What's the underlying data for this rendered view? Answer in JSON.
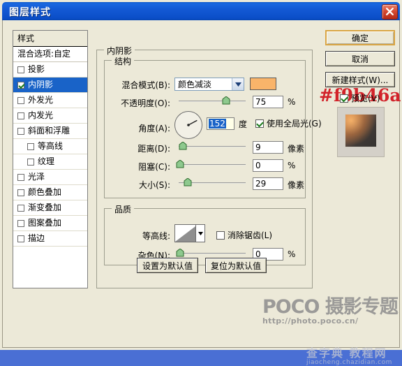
{
  "window": {
    "title": "图层样式",
    "close_icon": "close-icon",
    "titlebar_color": "#1359d4"
  },
  "sidebar": {
    "header": "样式",
    "blending": "混合选项:自定",
    "items": [
      {
        "label": "投影",
        "checked": false,
        "indent": false,
        "selected": false
      },
      {
        "label": "内阴影",
        "checked": true,
        "indent": false,
        "selected": true
      },
      {
        "label": "外发光",
        "checked": false,
        "indent": false,
        "selected": false
      },
      {
        "label": "内发光",
        "checked": false,
        "indent": false,
        "selected": false
      },
      {
        "label": "斜面和浮雕",
        "checked": false,
        "indent": false,
        "selected": false
      },
      {
        "label": "等高线",
        "checked": false,
        "indent": true,
        "selected": false
      },
      {
        "label": "纹理",
        "checked": false,
        "indent": true,
        "selected": false
      },
      {
        "label": "光泽",
        "checked": false,
        "indent": false,
        "selected": false
      },
      {
        "label": "颜色叠加",
        "checked": false,
        "indent": false,
        "selected": false
      },
      {
        "label": "渐变叠加",
        "checked": false,
        "indent": false,
        "selected": false
      },
      {
        "label": "图案叠加",
        "checked": false,
        "indent": false,
        "selected": false
      },
      {
        "label": "描边",
        "checked": false,
        "indent": false,
        "selected": false
      }
    ]
  },
  "main": {
    "group_title": "内阴影",
    "hex_annotation": "#f9b46a",
    "structure": {
      "legend": "结构",
      "blend_mode": {
        "label": "混合模式(B):",
        "value": "颜色减淡",
        "color": "#f9b46a"
      },
      "opacity": {
        "label": "不透明度(O):",
        "value": "75",
        "unit": "%",
        "percent": 75
      },
      "angle": {
        "label": "角度(A):",
        "value": "152",
        "unit": "度",
        "degrees": 152,
        "use_global_light": {
          "label": "使用全局光(G)",
          "checked": true
        }
      },
      "distance": {
        "label": "距离(D):",
        "value": "9",
        "unit": "像素",
        "percent": 4
      },
      "choke": {
        "label": "阻塞(C):",
        "value": "0",
        "unit": "%",
        "percent": 0
      },
      "size": {
        "label": "大小(S):",
        "value": "29",
        "unit": "像素",
        "percent": 12
      }
    },
    "quality": {
      "legend": "品质",
      "contour": {
        "label": "等高线:",
        "icon": "contour-swatch"
      },
      "anti_alias": {
        "label": "消除锯齿(L)",
        "checked": false
      },
      "noise": {
        "label": "杂色(N):",
        "value": "0",
        "unit": "%",
        "percent": 0
      }
    },
    "set_default": "设置为默认值",
    "reset_default": "复位为默认值"
  },
  "buttons": {
    "ok": "确定",
    "cancel": "取消",
    "new_style": "新建样式(W)...",
    "preview": {
      "label": "预览(V)",
      "checked": true
    }
  },
  "watermarks": {
    "poco_brand": "POCO 摄影专题",
    "poco_url": "http://photo.poco.cn/",
    "site_name": "查字典 教程网",
    "site_url": "jiaocheng.chazidian.com"
  }
}
